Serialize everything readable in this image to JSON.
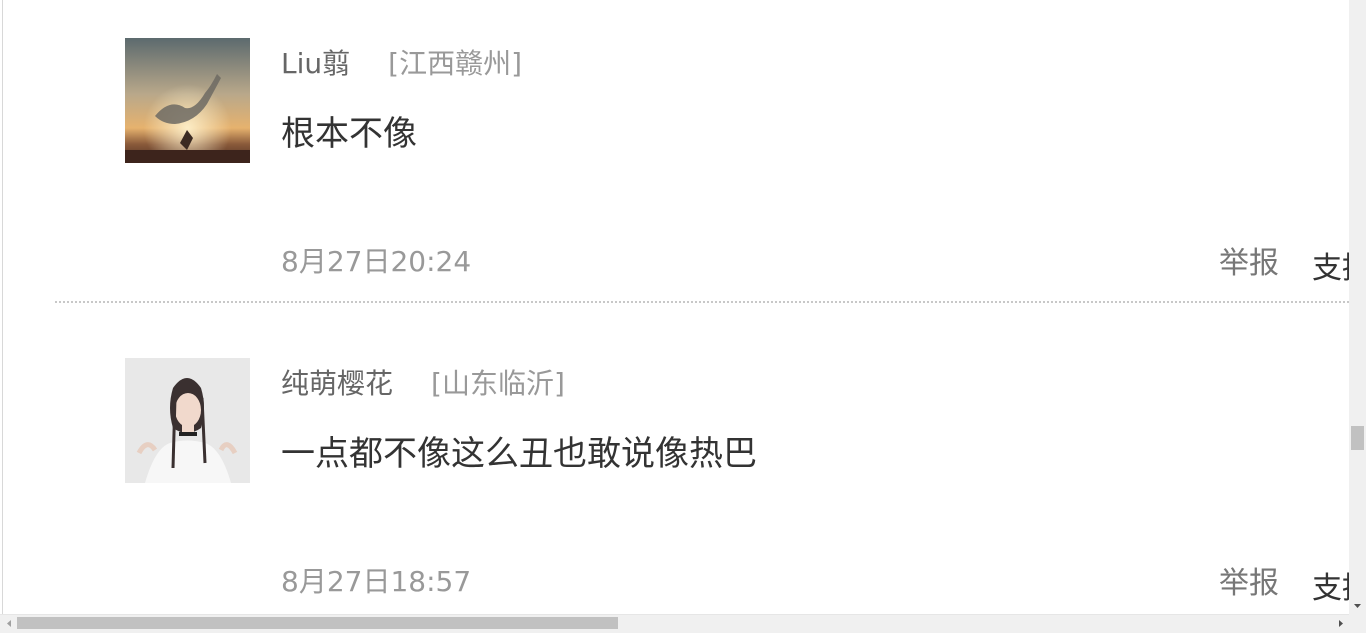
{
  "comments": [
    {
      "username": "Liu翦",
      "location": "[江西赣州]",
      "content": "根本不像",
      "time": "8月27日20:24",
      "report_label": "举报",
      "support_label": "支持"
    },
    {
      "username": "纯萌樱花",
      "location": "[山东临沂]",
      "content": "一点都不像这么丑也敢说像热巴",
      "time": "8月27日18:57",
      "report_label": "举报",
      "support_label": "支持"
    }
  ],
  "icons": {
    "scroll_left": "triangle-left-icon",
    "scroll_right": "triangle-right-icon",
    "scroll_down": "triangle-down-icon"
  },
  "colors": {
    "username": "#666666",
    "location": "#999999",
    "content": "#333333",
    "divider": "#c8c8c8"
  }
}
